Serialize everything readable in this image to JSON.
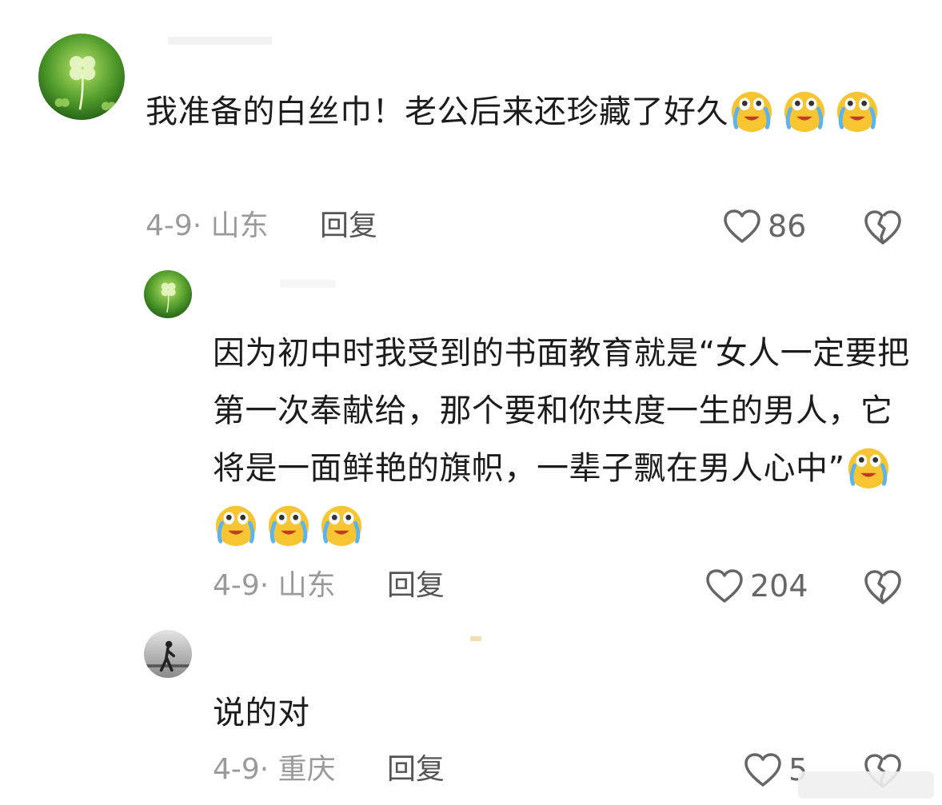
{
  "comments": [
    {
      "text": "我准备的白丝巾！老公后来还珍藏了好久",
      "emoji_count": 3,
      "date_location": "4-9· 山东",
      "reply_label": "回复",
      "likes": "86"
    },
    {
      "text": "因为初中时我受到的书面教育就是“女人一定要把第一次奉献给，那个要和你共度一生的男人，它将是一面鲜艳的旗帜，一辈子飘在男人心中”",
      "emoji_count": 4,
      "date_location": "4-9· 山东",
      "reply_label": "回复",
      "likes": "204"
    },
    {
      "text": "说的对",
      "date_location": "4-9· 重庆",
      "reply_label": "回复",
      "likes": "5"
    }
  ],
  "icons": {
    "like": "heart-outline-icon",
    "dislike": "broken-heart-icon",
    "emoji": "crying-laughing-emoji-icon"
  },
  "colors": {
    "text": "#1c1c1c",
    "meta": "#9a9a9a",
    "reply": "#555555",
    "clover_green": "#3c8c2a"
  }
}
